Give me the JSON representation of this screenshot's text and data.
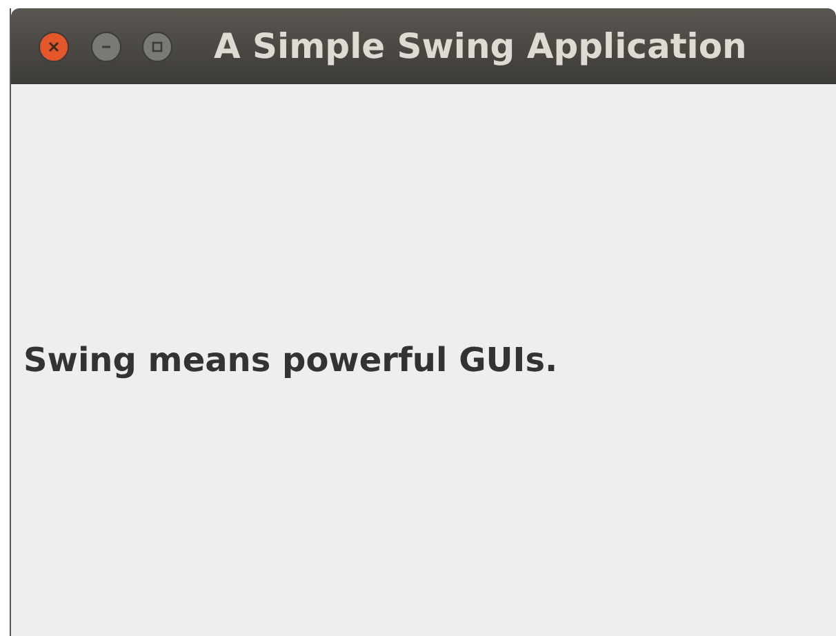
{
  "window": {
    "title": "A Simple Swing Application"
  },
  "content": {
    "label": "Swing means powerful GUIs."
  }
}
